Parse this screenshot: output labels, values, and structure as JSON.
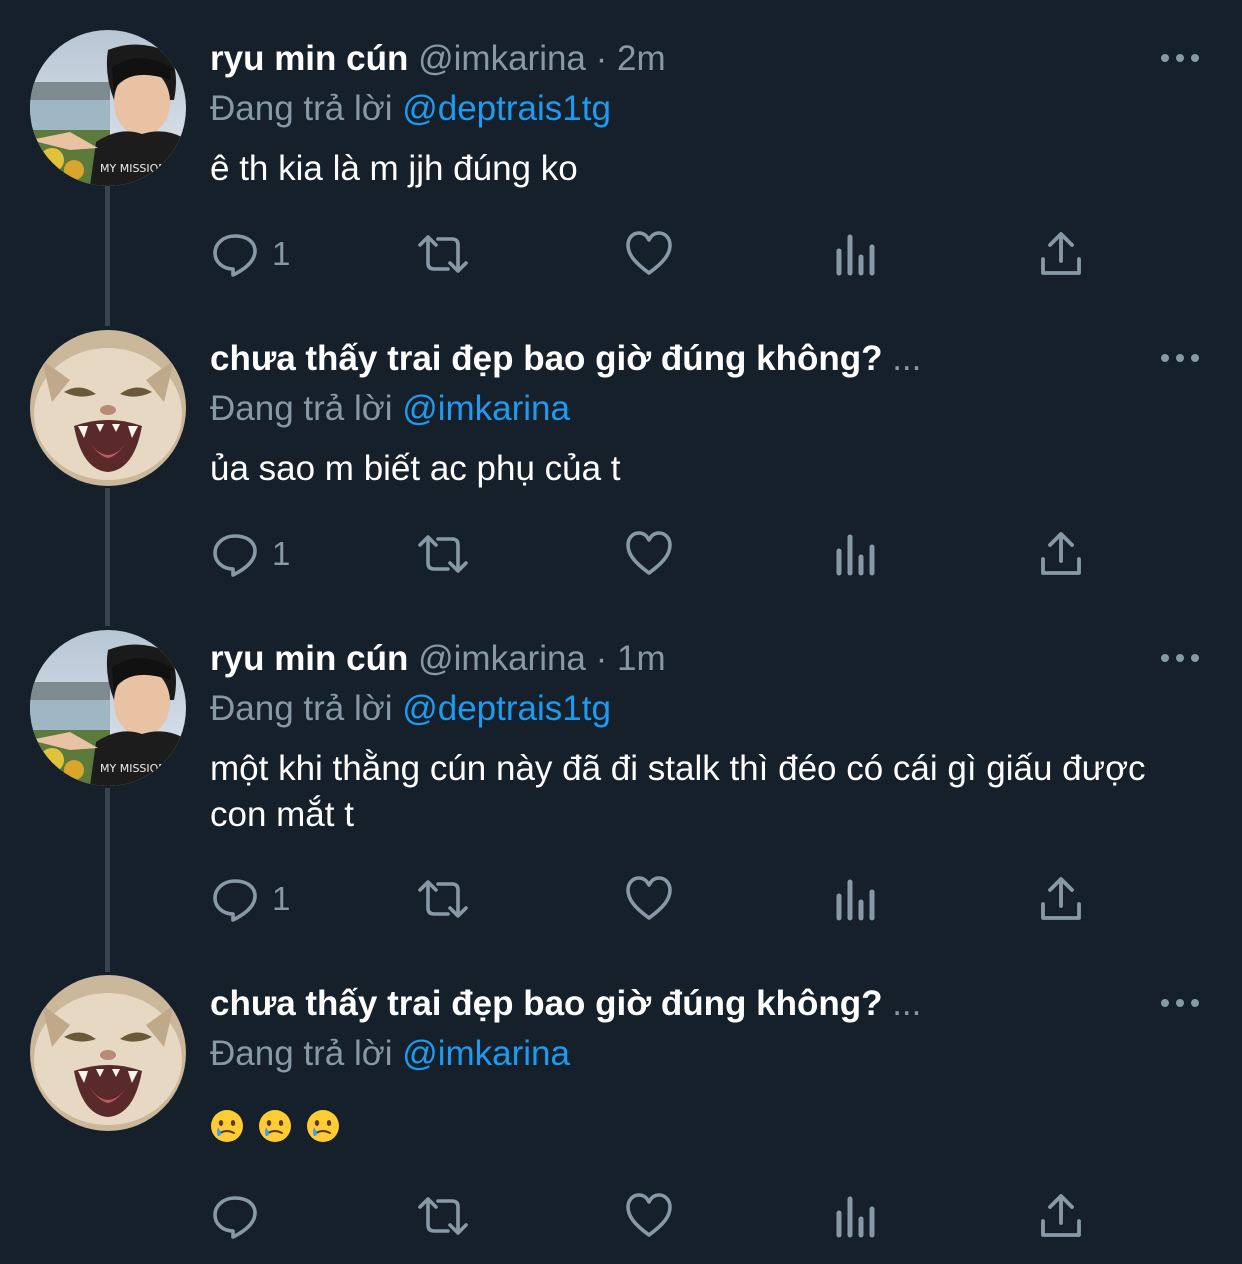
{
  "colors": {
    "background": "#15202b",
    "text_primary": "#ffffff",
    "text_secondary": "#8899a6",
    "link": "#1d9bf0",
    "thread_line": "#38444d"
  },
  "tweets": [
    {
      "name": "ryu min cún",
      "handle": "@imkarina",
      "separator": "·",
      "time": "2m",
      "reply_prefix": "Đang trả lời",
      "reply_to": "@deptrais1tg",
      "text": "ê th kia là m jjh đúng ko",
      "reply_count": "1",
      "avatar_icon": "person-avatar-icon"
    },
    {
      "name": "chưa thấy trai đẹp bao giờ đúng không?",
      "truncation": "...",
      "reply_prefix": "Đang trả lời",
      "reply_to": "@imkarina",
      "text": "ủa sao m biết ac phụ của t",
      "reply_count": "1",
      "avatar_icon": "cat-avatar-icon"
    },
    {
      "name": "ryu min cún",
      "handle": "@imkarina",
      "separator": "·",
      "time": "1m",
      "reply_prefix": "Đang trả lời",
      "reply_to": "@deptrais1tg",
      "text": "một khi thằng cún này đã đi stalk thì đéo có cái gì giấu được con mắt t",
      "reply_count": "1",
      "avatar_icon": "person-avatar-icon"
    },
    {
      "name": "chưa thấy trai đẹp bao giờ đúng không?",
      "truncation": "...",
      "reply_prefix": "Đang trả lời",
      "reply_to": "@imkarina",
      "emojis": [
        "face-holding-back-tears-icon",
        "face-holding-back-tears-icon",
        "face-holding-back-tears-icon"
      ],
      "reply_count": "",
      "avatar_icon": "cat-avatar-icon"
    }
  ],
  "action_icons": [
    "reply-icon",
    "retweet-icon",
    "like-icon",
    "analytics-icon",
    "share-icon"
  ]
}
